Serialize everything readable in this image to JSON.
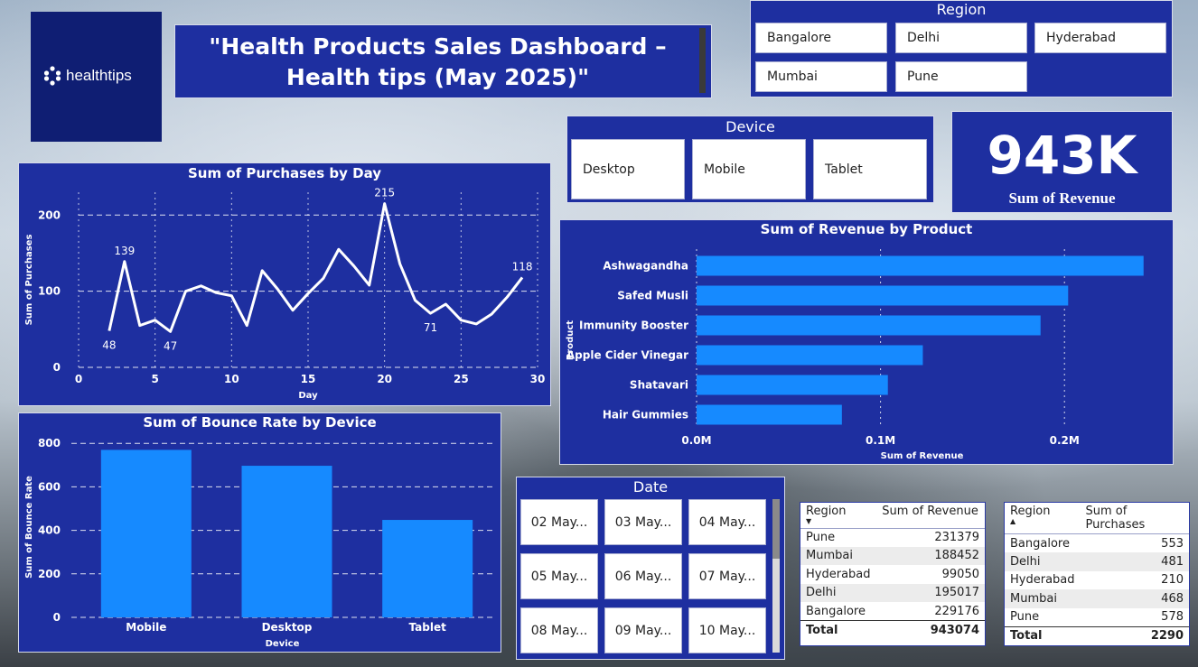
{
  "brand": {
    "logo_text": "healthtips"
  },
  "title": "\"Health Products Sales Dashboard – Health tips (May 2025)\"",
  "region_slicer": {
    "title": "Region",
    "options": [
      "Bangalore",
      "Delhi",
      "Hyderabad",
      "Mumbai",
      "Pune"
    ]
  },
  "device_slicer": {
    "title": "Device",
    "options": [
      "Desktop",
      "Mobile",
      "Tablet"
    ]
  },
  "kpi": {
    "value": "943K",
    "label": "Sum of Revenue"
  },
  "date_slicer": {
    "title": "Date",
    "options": [
      "02 May...",
      "03 May...",
      "04 May...",
      "05 May...",
      "06 May...",
      "07 May...",
      "08 May...",
      "09 May...",
      "10 May..."
    ]
  },
  "chart_data": [
    {
      "type": "line",
      "title": "Sum of Purchases by Day",
      "xlabel": "Day",
      "ylabel": "Sum of Purchases",
      "x": [
        2,
        3,
        4,
        5,
        6,
        7,
        8,
        9,
        10,
        11,
        12,
        13,
        14,
        15,
        16,
        17,
        18,
        19,
        20,
        21,
        22,
        23,
        24,
        25,
        26,
        27,
        28,
        29
      ],
      "y": [
        48,
        139,
        55,
        62,
        47,
        100,
        107,
        98,
        94,
        55,
        127,
        103,
        75,
        97,
        117,
        155,
        133,
        108,
        215,
        136,
        88,
        71,
        83,
        62,
        57,
        70,
        92,
        118
      ],
      "data_labels": [
        {
          "x": 2,
          "text": "48",
          "pos": "below"
        },
        {
          "x": 3,
          "text": "139",
          "pos": "above"
        },
        {
          "x": 6,
          "text": "47",
          "pos": "below"
        },
        {
          "x": 20,
          "text": "215",
          "pos": "above"
        },
        {
          "x": 23,
          "text": "71",
          "pos": "below"
        },
        {
          "x": 29,
          "text": "118",
          "pos": "above"
        }
      ],
      "xlim": [
        0,
        30
      ],
      "ylim": [
        0,
        230
      ],
      "xticks": [
        0,
        5,
        10,
        15,
        20,
        25,
        30
      ],
      "yticks": [
        0,
        100,
        200
      ],
      "grid": true
    },
    {
      "type": "bar",
      "orientation": "horizontal",
      "title": "Sum of Revenue by Product",
      "xlabel": "Sum of Revenue",
      "ylabel": "Product",
      "categories": [
        "Ashwagandha",
        "Safed Musli",
        "Immunity Booster",
        "Apple Cider Vinegar",
        "Shatavari",
        "Hair Gummies"
      ],
      "values": [
        243000,
        202000,
        187000,
        123000,
        104000,
        79000
      ],
      "xlim": [
        0,
        250000
      ],
      "xticks": [
        0,
        100000,
        200000
      ],
      "xtick_labels": [
        "0.0M",
        "0.1M",
        "0.2M"
      ],
      "grid": true
    },
    {
      "type": "bar",
      "title": "Sum of Bounce Rate by Device",
      "xlabel": "Device",
      "ylabel": "Sum of Bounce Rate",
      "categories": [
        "Mobile",
        "Desktop",
        "Tablet"
      ],
      "values": [
        770,
        697,
        448
      ],
      "ylim": [
        0,
        830
      ],
      "yticks": [
        0,
        200,
        400,
        600,
        800
      ],
      "grid": true
    }
  ],
  "revenue_table": {
    "headers": [
      "Region",
      "Sum of Revenue"
    ],
    "rows": [
      [
        "Pune",
        "231379"
      ],
      [
        "Mumbai",
        "188452"
      ],
      [
        "Hyderabad",
        "99050"
      ],
      [
        "Delhi",
        "195017"
      ],
      [
        "Bangalore",
        "229176"
      ]
    ],
    "total": [
      "Total",
      "943074"
    ],
    "sort": "desc"
  },
  "purchases_table": {
    "headers": [
      "Region",
      "Sum of Purchases"
    ],
    "rows": [
      [
        "Bangalore",
        "553"
      ],
      [
        "Delhi",
        "481"
      ],
      [
        "Hyderabad",
        "210"
      ],
      [
        "Mumbai",
        "468"
      ],
      [
        "Pune",
        "578"
      ]
    ],
    "total": [
      "Total",
      "2290"
    ],
    "sort": "asc"
  },
  "colors": {
    "panel": "#1e2fa0",
    "bar": "#168aff",
    "line": "#ffffff",
    "logo_bg": "#0f1e73"
  }
}
